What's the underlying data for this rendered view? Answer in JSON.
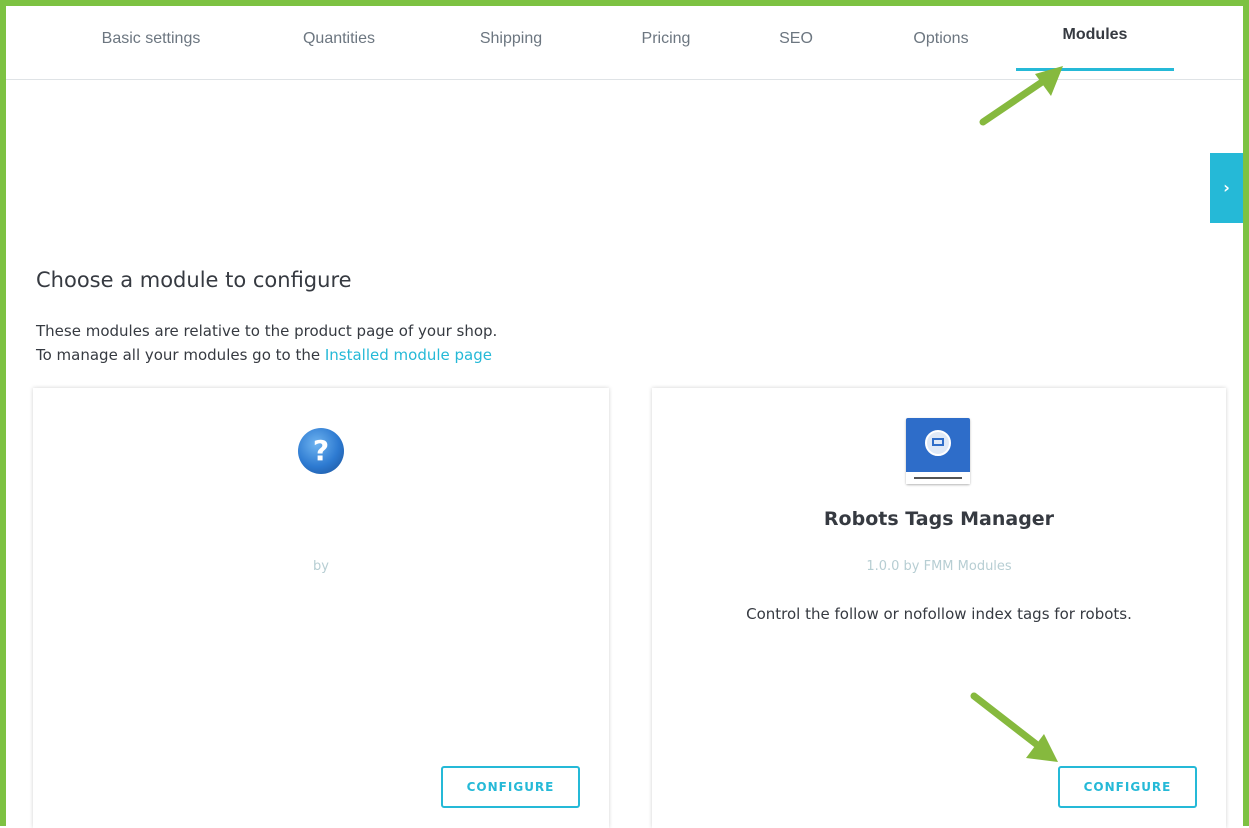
{
  "tabs": [
    {
      "label": "Basic settings",
      "active": false
    },
    {
      "label": "Quantities",
      "active": false
    },
    {
      "label": "Shipping",
      "active": false
    },
    {
      "label": "Pricing",
      "active": false
    },
    {
      "label": "SEO",
      "active": false
    },
    {
      "label": "Options",
      "active": false
    },
    {
      "label": "Modules",
      "active": true
    }
  ],
  "side_toggle": {
    "icon": "chevron-right-icon",
    "glyph": "›"
  },
  "page": {
    "heading": "Choose a module to configure",
    "intro_line1": "These modules are relative to the product page of your shop.",
    "intro_line2_prefix": "To manage all your modules go to the",
    "intro_link": "Installed module page"
  },
  "modules": [
    {
      "icon": "question-mark-icon",
      "icon_glyph": "?",
      "name": "",
      "by": "by",
      "description": "",
      "configure_label": "CONFIGURE"
    },
    {
      "icon": "robots-tags-manager-logo",
      "name": "Robots Tags Manager",
      "by": "1.0.0 by FMM Modules",
      "description": "Control the follow or nofollow index tags for robots.",
      "configure_label": "CONFIGURE"
    }
  ],
  "colors": {
    "accent": "#25b9d7",
    "frame": "#7dc242",
    "annotation_arrow": "#86b93e"
  }
}
